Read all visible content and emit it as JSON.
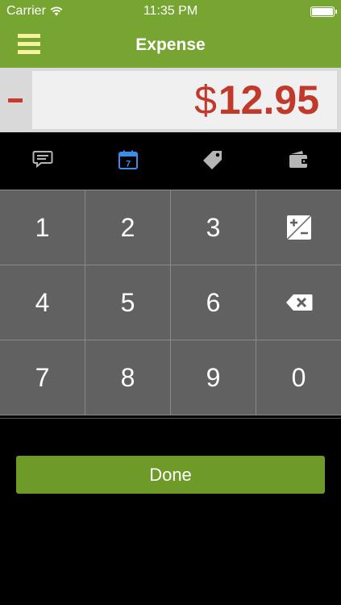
{
  "status_bar": {
    "carrier": "Carrier",
    "time": "11:35 PM",
    "battery_level": 1.0
  },
  "nav": {
    "title": "Expense",
    "menu_icon": "hamburger-menu-icon"
  },
  "amount": {
    "sign": "-",
    "currency": "$",
    "value": "12.95",
    "color": "#c0392b"
  },
  "tabs": [
    {
      "icon": "comment-icon",
      "active": false
    },
    {
      "icon": "calendar-icon",
      "label": "7",
      "active": true
    },
    {
      "icon": "tag-icon",
      "active": false
    },
    {
      "icon": "wallet-icon",
      "active": false
    }
  ],
  "keypad": {
    "keys": [
      "1",
      "2",
      "3",
      "plus-minus",
      "4",
      "5",
      "6",
      "backspace",
      "7",
      "8",
      "9",
      "0"
    ]
  },
  "done_label": "Done",
  "colors": {
    "brand_green": "#77a532",
    "active_tab": "#3b8de8",
    "inactive_tab": "#b5b5b5",
    "key_bg": "#616161"
  }
}
